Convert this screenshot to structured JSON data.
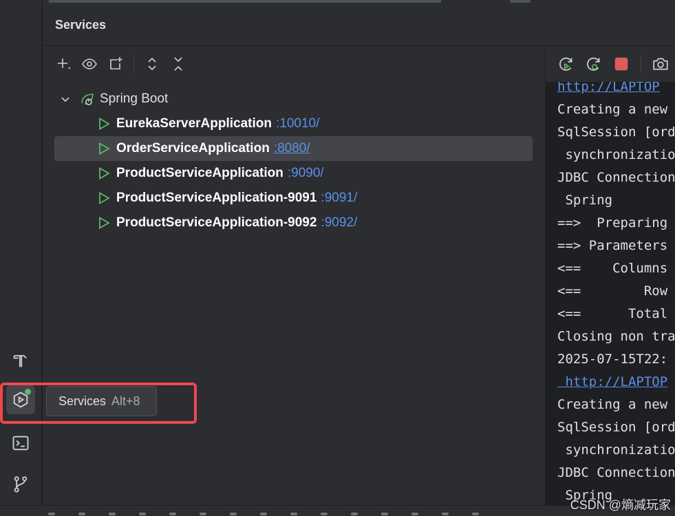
{
  "panel": {
    "title": "Services"
  },
  "toolbar": {
    "icons": [
      "add-icon",
      "eye-icon",
      "new-group-icon",
      "expand-all-icon",
      "collapse-all-icon"
    ]
  },
  "tree": {
    "group_label": "Spring Boot",
    "apps": [
      {
        "name": "EurekaServerApplication",
        "port": ":10010/",
        "selected": false
      },
      {
        "name": "OrderServiceApplication",
        "port": ":8080/",
        "selected": true
      },
      {
        "name": "ProductServiceApplication",
        "port": ":9090/",
        "selected": false
      },
      {
        "name": "ProductServiceApplication-9091",
        "port": ":9091/",
        "selected": false
      },
      {
        "name": "ProductServiceApplication-9092",
        "port": ":9092/",
        "selected": false
      }
    ]
  },
  "console": {
    "lines": [
      "http://LAPTOP",
      "Creating a new",
      "SqlSession [ord",
      " synchronizatio",
      "JDBC Connection",
      " Spring",
      "==>  Preparing",
      "==> Parameters",
      "<==    Columns",
      "<==        Row",
      "<==      Total",
      "Closing non tra",
      "2025-07-15T22:",
      " http://LAPTOP",
      "Creating a new",
      "SqlSession [ord",
      " synchronizatio",
      "JDBC Connection",
      " Spring"
    ]
  },
  "tooltip": {
    "label": "Services",
    "shortcut": "Alt+8"
  },
  "watermark": "CSDN @熵减玩家",
  "colors": {
    "accent_link": "#5d8fe8",
    "run_icon": "#5fb865",
    "stop_icon": "#e55b5b",
    "highlight_box": "#f0474f"
  }
}
